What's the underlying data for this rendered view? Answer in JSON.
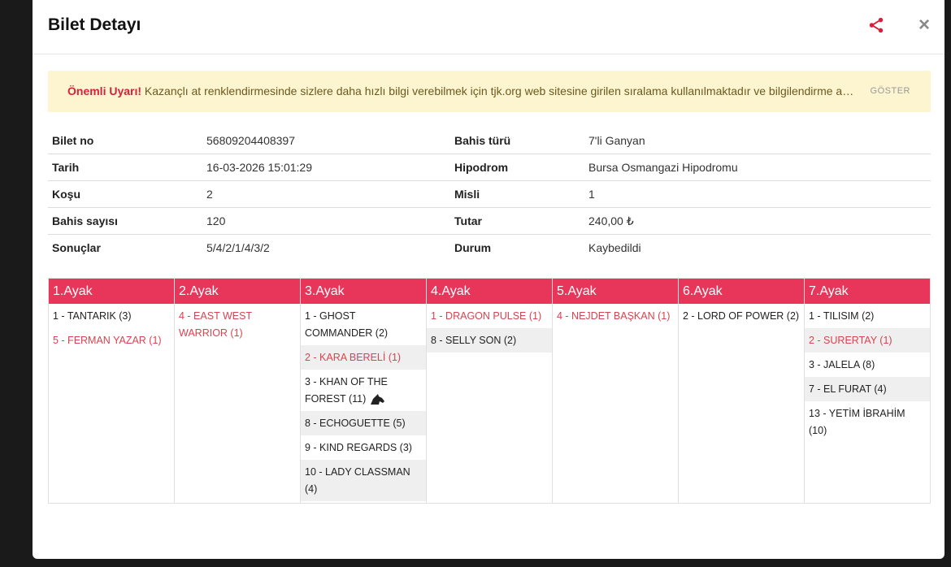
{
  "modal": {
    "title": "Bilet Detayı",
    "share_icon": "share-icon",
    "close_icon": "close-icon",
    "close_glyph": "×"
  },
  "warning": {
    "strong": "Önemli Uyarı!",
    "text": " Kazançlı at renklendirmesinde sizlere daha hızlı bilgi verebilmek için tjk.org web sitesine girilen sıralama kullanılmaktadır ve bilgilendirme amaçlıdır.",
    "show_label": "GÖSTER",
    "colors": {
      "background": "#fdf4d0",
      "strong": "#d8203a"
    }
  },
  "ticket": {
    "rows": [
      {
        "l1": "Bilet no",
        "v1": "56809204408397",
        "l2": "Bahis türü",
        "v2": "7'li Ganyan"
      },
      {
        "l1": "Tarih",
        "v1": "16-03-2026 15:01:29",
        "l2": "Hipodrom",
        "v2": "Bursa Osmangazi Hipodromu"
      },
      {
        "l1": "Koşu",
        "v1": "2",
        "l2": "Misli",
        "v2": "1"
      },
      {
        "l1": "Bahis sayısı",
        "v1": "120",
        "l2": "Tutar",
        "v2": "240,00 ₺"
      },
      {
        "l1": "Sonuçlar",
        "v1": "5/4/2/1/4/3/2",
        "l2": "Durum",
        "v2": "Kaybedildi"
      }
    ]
  },
  "legs": [
    {
      "title": "1.Ayak",
      "horses": [
        {
          "text": "1 - TANTARIK (3)",
          "win": false,
          "alt": false
        },
        {
          "text": "5 - FERMAN YAZAR (1)",
          "win": true,
          "alt": false
        }
      ]
    },
    {
      "title": "2.Ayak",
      "horses": [
        {
          "text": "4 - EAST WEST WARRIOR (1)",
          "win": true,
          "alt": false
        }
      ]
    },
    {
      "title": "3.Ayak",
      "horses": [
        {
          "text": "1 - GHOST COMMANDER (2)",
          "win": false,
          "alt": false
        },
        {
          "text": "2 - KARA BERELİ (1)",
          "win": true,
          "alt": true
        },
        {
          "text": "3 - KHAN OF THE FOREST (11)",
          "win": false,
          "alt": false,
          "icon": "horse-head-icon"
        },
        {
          "text": "8 - ECHOGUETTE (5)",
          "win": false,
          "alt": true
        },
        {
          "text": "9 - KIND REGARDS (3)",
          "win": false,
          "alt": false
        },
        {
          "text": "10 - LADY CLASSMAN (4)",
          "win": false,
          "alt": true
        }
      ]
    },
    {
      "title": "4.Ayak",
      "horses": [
        {
          "text": "1 - DRAGON PULSE (1)",
          "win": true,
          "alt": false
        },
        {
          "text": "8 - SELLY SON (2)",
          "win": false,
          "alt": true
        }
      ]
    },
    {
      "title": "5.Ayak",
      "horses": [
        {
          "text": "4 - NEJDET BAŞKAN (1)",
          "win": true,
          "alt": false
        }
      ]
    },
    {
      "title": "6.Ayak",
      "horses": [
        {
          "text": "2 - LORD OF POWER (2)",
          "win": false,
          "alt": false
        }
      ]
    },
    {
      "title": "7.Ayak",
      "horses": [
        {
          "text": "1 - TILISIM (2)",
          "win": false,
          "alt": false
        },
        {
          "text": "2 - SURERTAY (1)",
          "win": true,
          "alt": true
        },
        {
          "text": "3 - JALELA (8)",
          "win": false,
          "alt": false
        },
        {
          "text": "7 - EL FURAT (4)",
          "win": false,
          "alt": true
        },
        {
          "text": "13 - YETİM İBRAHİM (10)",
          "win": false,
          "alt": false
        }
      ]
    }
  ],
  "colors": {
    "accent": "#e8365a",
    "winner": "#d8434f",
    "share": "#d8203a"
  }
}
